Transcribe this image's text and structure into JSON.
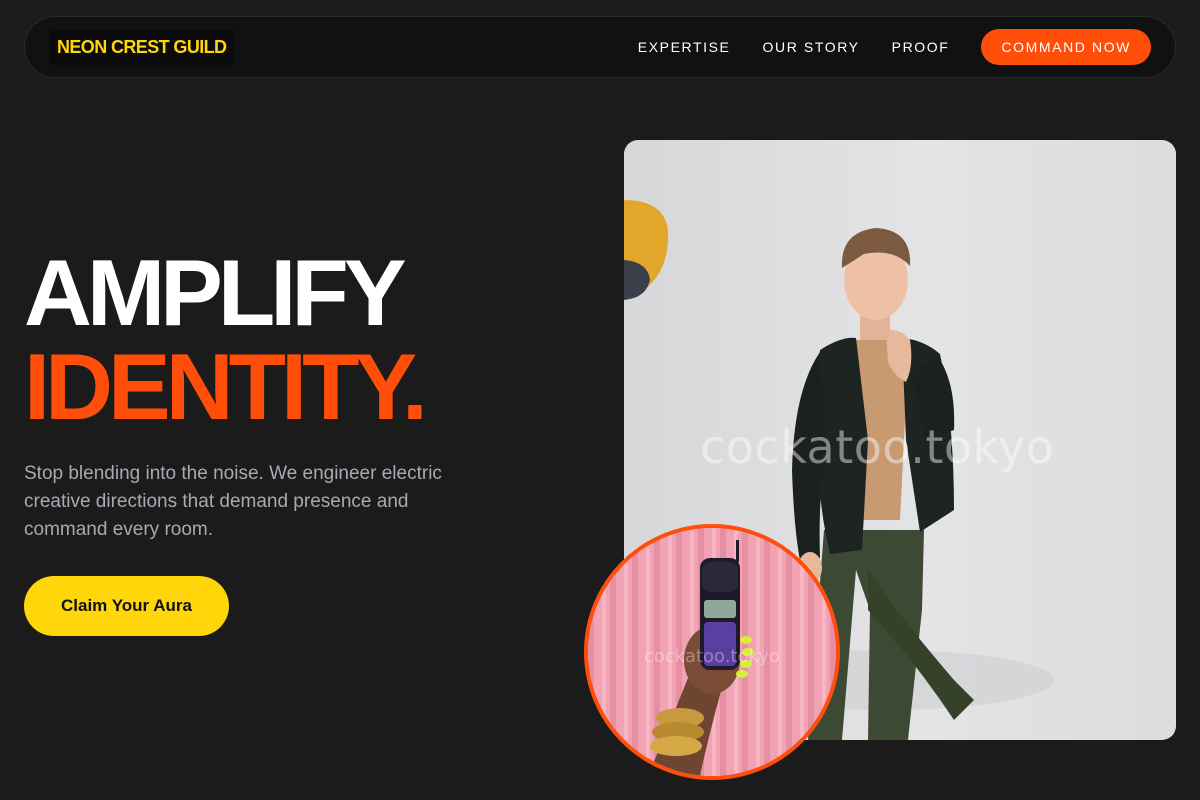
{
  "nav": {
    "logo": "NEON CREST GUILD",
    "links": [
      "EXPERTISE",
      "OUR STORY",
      "PROOF"
    ],
    "cta": "COMMAND NOW"
  },
  "hero": {
    "title_line1": "AMPLIFY",
    "title_line2": "IDENTITY.",
    "subtitle": "Stop blending into the noise. We engineer electric creative directions that demand presence and command every room.",
    "cta": "Claim Your Aura"
  },
  "images": {
    "main_photo_watermark": "cockatoo.tokyo",
    "circle_photo_watermark": "cockatoo.tokyo"
  },
  "colors": {
    "background": "#1b1b1b",
    "accent_orange": "#ff4d0a",
    "accent_yellow": "#ffd60a",
    "muted_text": "#a9a9b3"
  }
}
